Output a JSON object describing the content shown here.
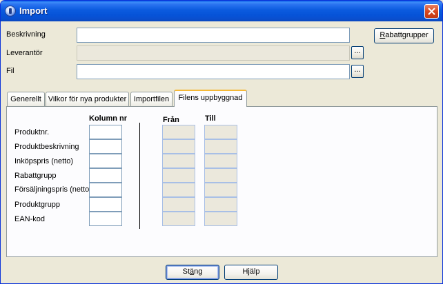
{
  "window": {
    "title": "Import"
  },
  "form": {
    "beskrivning_label": "Beskrivning",
    "beskrivning_value": "",
    "leverantor_label": "Leverantör",
    "leverantor_value": "",
    "fil_label": "Fil",
    "fil_value": "",
    "browse_label": "...",
    "rabattgrupper_button": {
      "accesskey": "R",
      "rest": "abattgrupper"
    }
  },
  "tabs": [
    {
      "label": "Generellt"
    },
    {
      "label": "Vilkor för nya produkter"
    },
    {
      "label": "Importfilen"
    },
    {
      "label": "Filens uppbyggnad",
      "active": true
    }
  ],
  "panel": {
    "col_kolumn": "Kolumn nr",
    "col_fran": "Från",
    "col_till": "Till",
    "rows": [
      {
        "label": "Produktnr.",
        "kolumn": "",
        "fran": "",
        "till": ""
      },
      {
        "label": "Produktbeskrivning",
        "kolumn": "",
        "fran": "",
        "till": ""
      },
      {
        "label": "Inköpspris (netto)",
        "kolumn": "",
        "fran": "",
        "till": ""
      },
      {
        "label": "Rabattgrupp",
        "kolumn": "",
        "fran": "",
        "till": ""
      },
      {
        "label": "Försäljningspris (netto)",
        "kolumn": "",
        "fran": "",
        "till": ""
      },
      {
        "label": "Produktgrupp",
        "kolumn": "",
        "fran": "",
        "till": ""
      },
      {
        "label": "EAN-kod",
        "kolumn": "",
        "fran": "",
        "till": ""
      }
    ]
  },
  "footer": {
    "stang": {
      "pre": "St",
      "accesskey": "ä",
      "post": "ng"
    },
    "hjalp": {
      "pre": "H",
      "accesskey": "j",
      "post": "älp"
    }
  }
}
